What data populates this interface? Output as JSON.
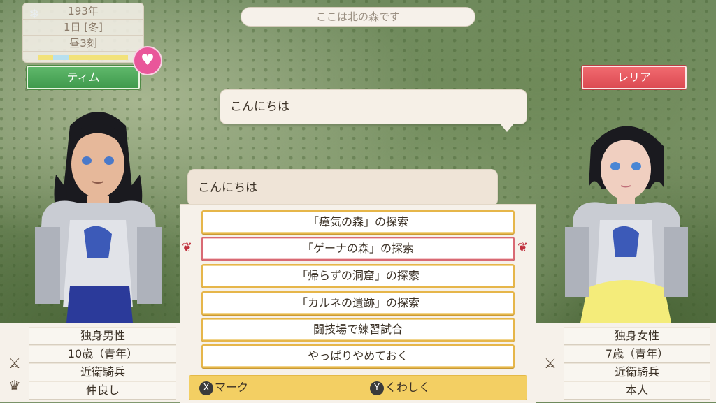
{
  "date": {
    "year": "193年",
    "day": "1日 [冬]",
    "time": "昼3刻"
  },
  "time_bar_colors": [
    "#f2e27a",
    "#b7e0ef",
    "#f2e27a",
    "#f2e27a",
    "#f2e27a",
    "#f2e27a"
  ],
  "location": "ここは北の森です",
  "left_character": {
    "name": "ティム",
    "stats": [
      "独身男性",
      "10歳（青年）",
      "近衛騎兵",
      "仲良し"
    ]
  },
  "right_character": {
    "name": "レリア",
    "stats": [
      "独身女性",
      "7歳（青年）",
      "近衛騎兵",
      "本人"
    ]
  },
  "bubbles": {
    "top": "こんにちは",
    "bottom": "こんにちは"
  },
  "choices": [
    "「瘴気の森」の探索",
    "「ゲーナの森」の探索",
    "「帰らずの洞窟」の探索",
    "「カルネの遺跡」の探索",
    "闘技場で練習試合",
    "やっぱりやめておく"
  ],
  "selected_choice": 1,
  "hints": {
    "mark_key": "X",
    "mark": "マーク",
    "detail_key": "Y",
    "detail": "くわしく"
  },
  "colors": {
    "accent_gold": "#e6b64a",
    "selected_red": "#d96a74",
    "male_plate": "#4fae5d",
    "female_plate": "#e8565e"
  },
  "icons": {
    "season": "snowflake-icon",
    "affection": "heart-icon",
    "job": "crossed-swords-icon",
    "relation": "crown-icon"
  }
}
